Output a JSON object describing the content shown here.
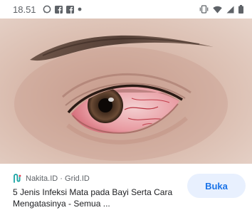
{
  "status_bar": {
    "time": "18.51",
    "left_icons": [
      "whatsapp-icon",
      "facebook-icon",
      "facebook-icon",
      "notification-dot-icon"
    ],
    "right_icons": [
      "vibrate-icon",
      "wifi-icon",
      "signal-icon",
      "battery-icon"
    ]
  },
  "result": {
    "source": "Nakita.ID · Grid.ID",
    "title_line1": "5 Jenis Infeksi Mata pada Bayi Serta Cara",
    "title_line2": "Mengatasinya - Semua ...",
    "open_label": "Buka"
  },
  "colors": {
    "accent": "#1a73e8",
    "button_bg": "#e8f0fe",
    "text_primary": "#202124",
    "text_secondary": "#5f6368"
  }
}
